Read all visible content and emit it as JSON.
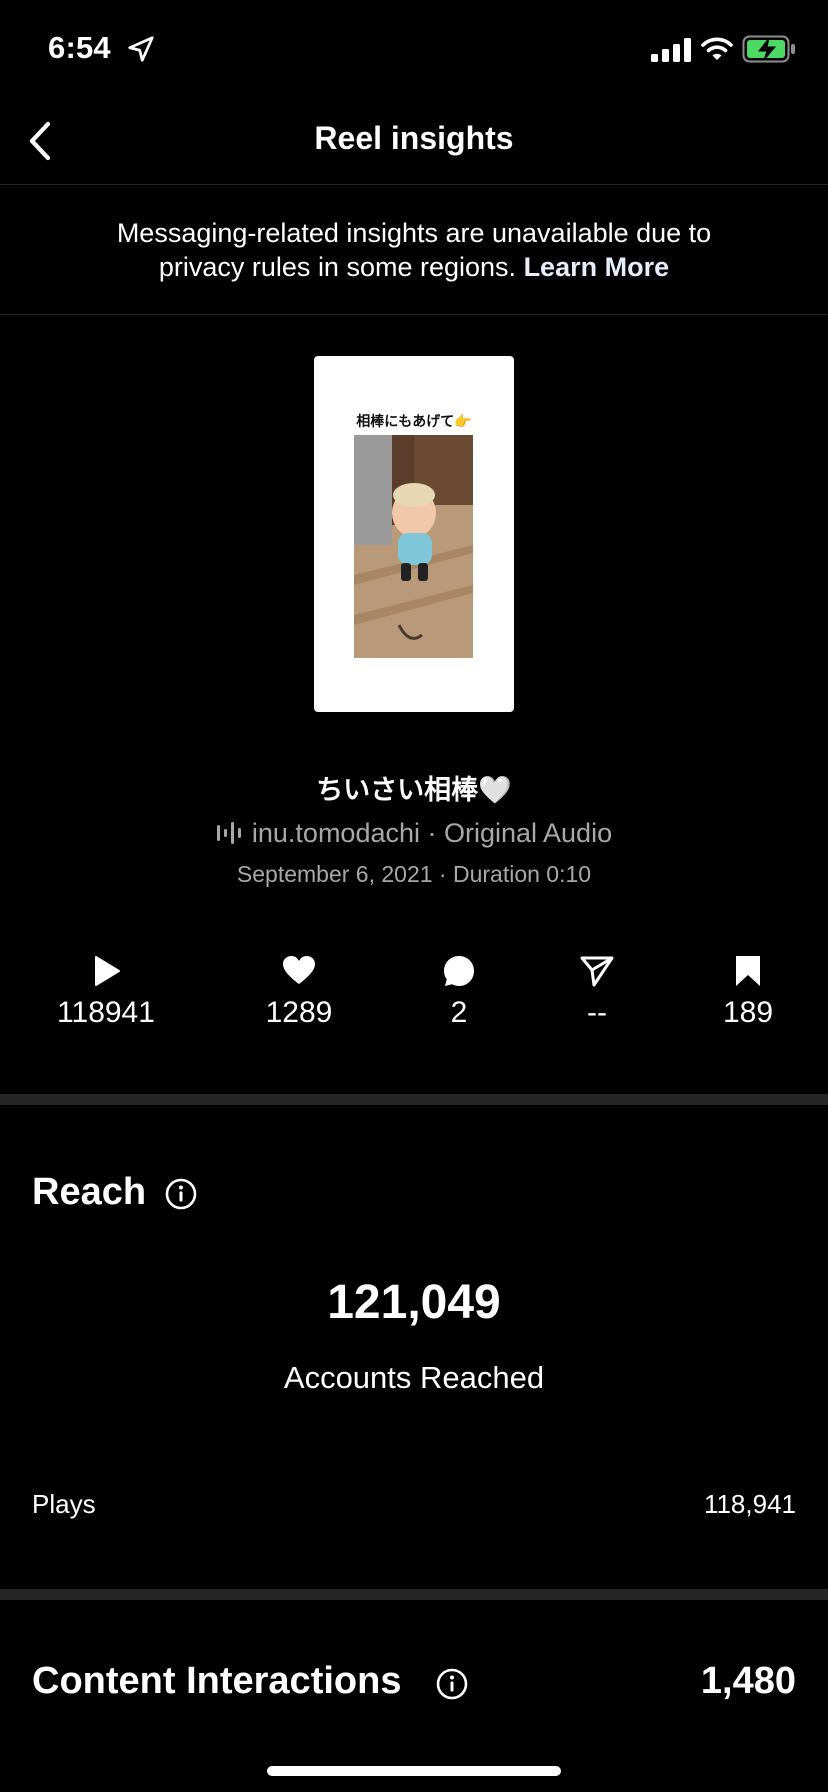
{
  "status_bar": {
    "time": "6:54"
  },
  "nav": {
    "title": "Reel insights"
  },
  "notice": {
    "line1": "Messaging-related insights are unavailable due to",
    "line2": "privacy rules in some regions.",
    "link": "Learn More"
  },
  "thumbnail": {
    "caption": "相棒にもあげて👉"
  },
  "reel": {
    "caption": "ちいさい相棒🤍",
    "audio": "inu.tomodachi · Original Audio",
    "meta": "September 6, 2021 · Duration 0:10"
  },
  "stats": {
    "plays": "118941",
    "likes": "1289",
    "comments": "2",
    "shares": "--",
    "saves": "189"
  },
  "reach": {
    "title": "Reach",
    "accounts_value": "121,049",
    "accounts_label": "Accounts Reached",
    "plays_label": "Plays",
    "plays_value": "118,941"
  },
  "content_interactions": {
    "title": "Content Interactions",
    "value": "1,480"
  }
}
